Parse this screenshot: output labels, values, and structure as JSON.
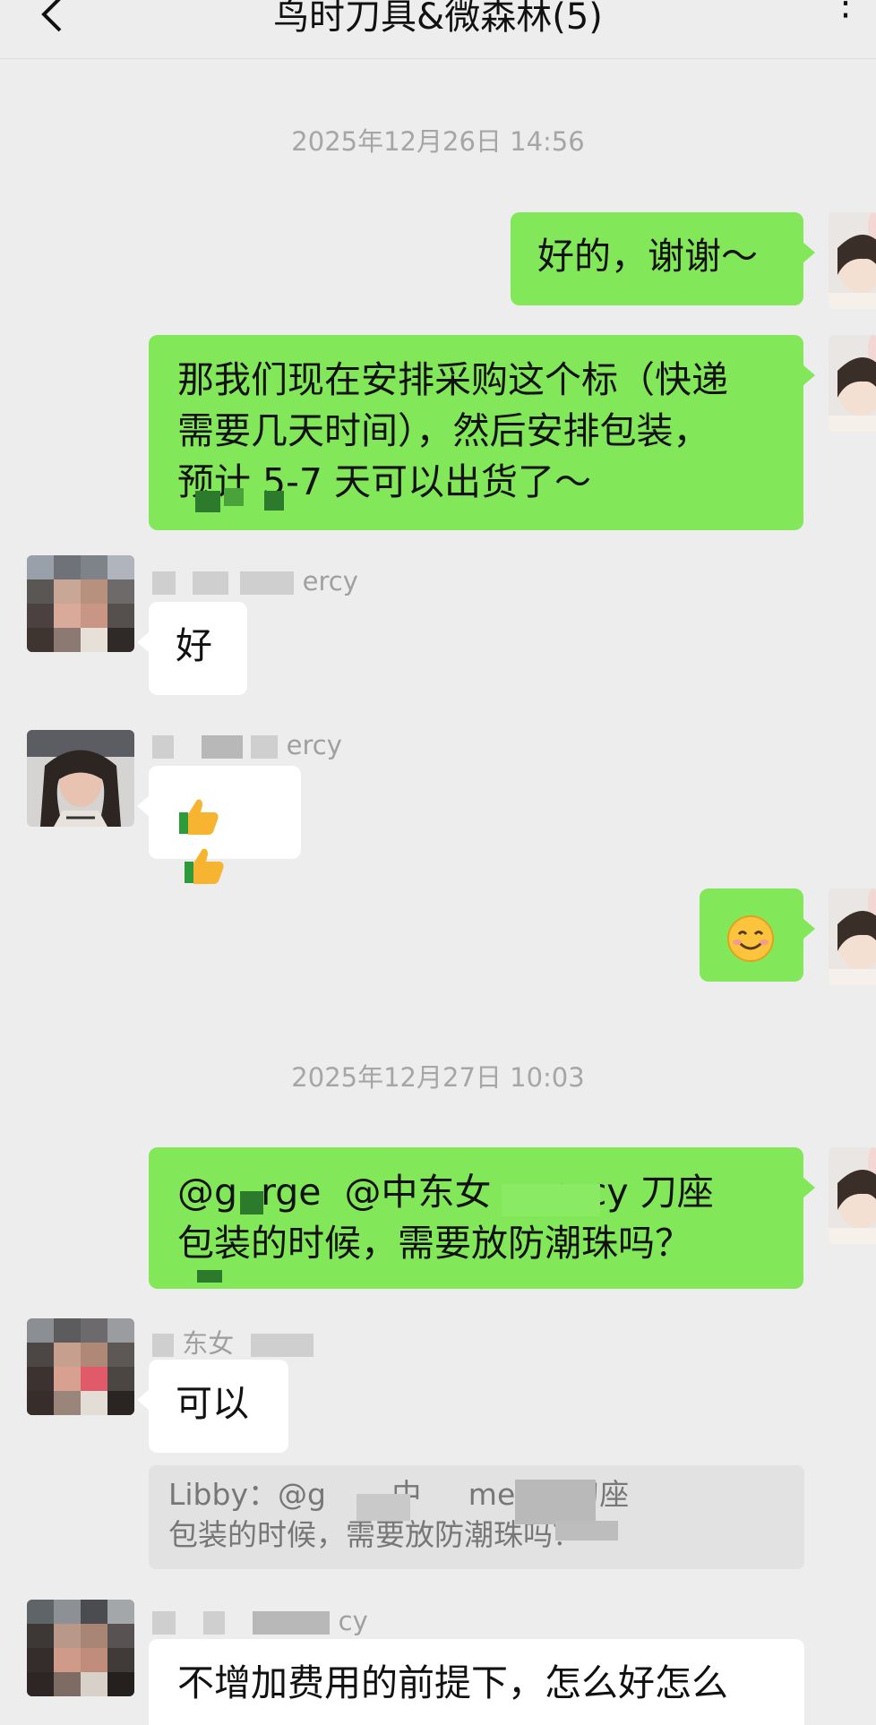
{
  "header": {
    "title": "鸟时刀具&微森林(5)",
    "back_icon": "back-arrow-icon",
    "more_icon": "more-dots-icon"
  },
  "messages": [
    {
      "type": "timestamp",
      "text": "2025年12月26日 14:56"
    },
    {
      "type": "out",
      "text": "好的，谢谢～"
    },
    {
      "type": "out",
      "lines": [
        "那我们现在安排采购这个标（快递",
        "需要几天时间），然后安排包装，",
        "预计 5-7 天可以出货了～"
      ]
    },
    {
      "type": "in",
      "sender_visible": "ercy",
      "text": "好"
    },
    {
      "type": "in",
      "sender_visible": "ercy",
      "emoji": [
        "thumbs-up-icon",
        "thumbs-up-icon"
      ]
    },
    {
      "type": "out",
      "emoji": "smiling-face-icon"
    },
    {
      "type": "timestamp",
      "text": "2025年12月27日 10:03"
    },
    {
      "type": "out",
      "lines": [
        "@g  rge  @中东女     ercy 刀座",
        "包装的时候，需要放防潮珠吗？"
      ]
    },
    {
      "type": "in",
      "sender_visible": "东女",
      "text": "可以",
      "quote_lines": [
        "Libby：@g       中     mercy 刀座",
        "包装的时候，需要放防潮珠吗？"
      ]
    },
    {
      "type": "in",
      "sender_visible": "cy",
      "text": "不增加费用的前提下，怎么好怎么"
    }
  ],
  "colors": {
    "background": "#ededed",
    "outgoing_bubble": "#82e85a",
    "incoming_bubble": "#ffffff",
    "timestamp_text": "#a6a6a6"
  }
}
